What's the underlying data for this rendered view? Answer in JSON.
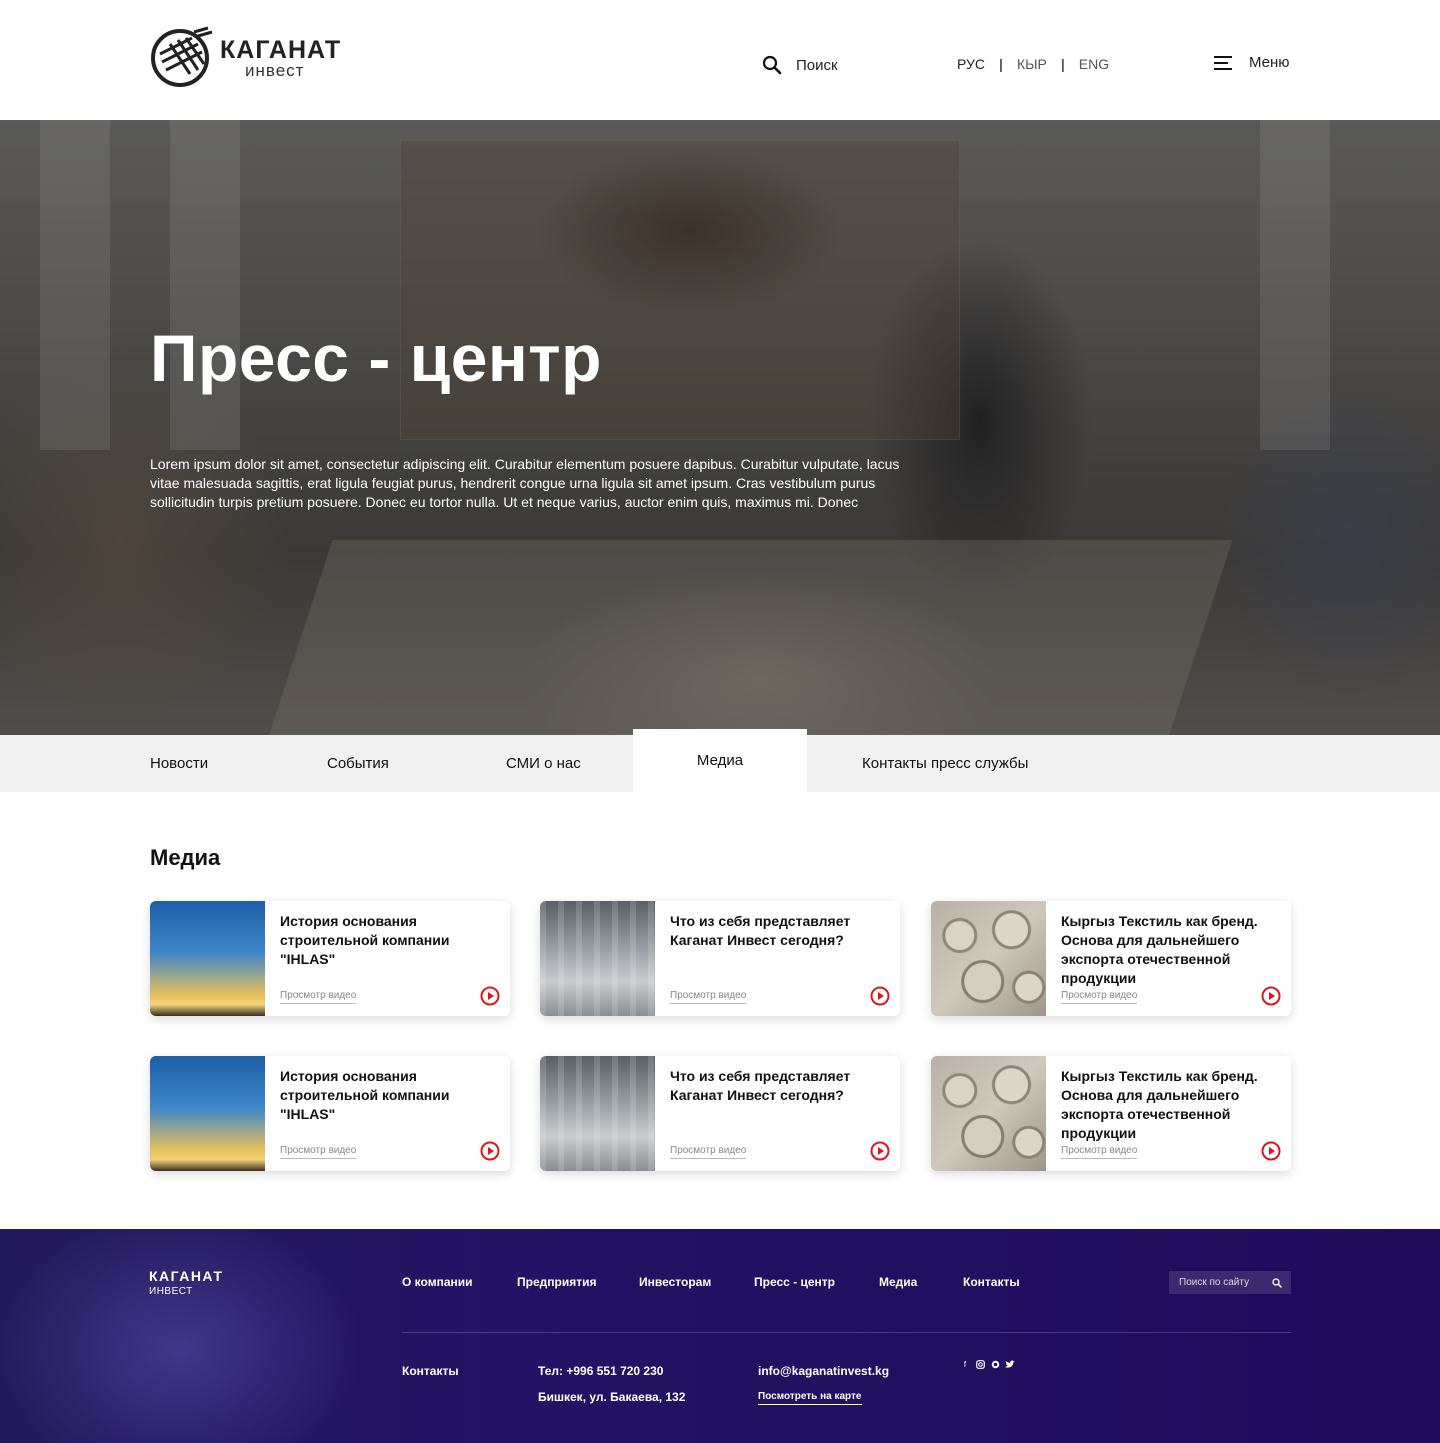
{
  "header": {
    "logo_title": "КАГАНАТ",
    "logo_sub": "инвест",
    "search_label": "Поиск",
    "languages": [
      "РУС",
      "КЫР",
      "ENG"
    ],
    "active_language": "РУС",
    "menu_label": "Меню"
  },
  "hero": {
    "title": "Пресс - центр",
    "text": "Lorem ipsum dolor sit amet, consectetur adipiscing elit. Curabitur elementum posuere dapibus. Curabitur vulputate, lacus vitae malesuada sagittis, erat ligula feugiat purus, hendrerit congue urna ligula sit amet ipsum. Cras vestibulum purus sollicitudin turpis pretium posuere. Donec eu tortor nulla. Ut et neque varius, auctor enim quis, maximus mi. Donec"
  },
  "tabs": [
    {
      "label": "Новости"
    },
    {
      "label": "События"
    },
    {
      "label": "СМИ о нас"
    },
    {
      "label": "Медиа"
    },
    {
      "label": "Контакты пресс службы"
    }
  ],
  "active_tab": "Медиа",
  "media": {
    "title": "Медиа",
    "cards": [
      {
        "title": "История основания строительной компании \"IHLAS\"",
        "link": "Просмотр видео",
        "thumb": "construction-crane-sunset"
      },
      {
        "title": "Что из себя представляет Каганат Инвест сегодня?",
        "link": "Просмотр видео",
        "thumb": "open-office"
      },
      {
        "title": "Кыргыз Текстиль как бренд. Основа для дальнейшего экспорта отечественной продукции",
        "link": "Просмотр видео",
        "thumb": "textile-rolls"
      },
      {
        "title": "История основания строительной компании \"IHLAS\"",
        "link": "Просмотр видео",
        "thumb": "construction-crane-sunset"
      },
      {
        "title": "Что из себя представляет Каганат Инвест сегодня?",
        "link": "Просмотр видео",
        "thumb": "open-office"
      },
      {
        "title": "Кыргыз Текстиль как бренд. Основа для дальнейшего экспорта отечественной продукции",
        "link": "Просмотр видео",
        "thumb": "textile-rolls"
      }
    ]
  },
  "footer": {
    "logo_title": "КАГАНАТ",
    "logo_sub": "ИНВЕСТ",
    "nav": [
      {
        "label": "О компании"
      },
      {
        "label": "Предприятия"
      },
      {
        "label": "Инвесторам"
      },
      {
        "label": "Пресс - центр"
      },
      {
        "label": "Медиа"
      },
      {
        "label": "Контакты"
      }
    ],
    "search_placeholder": "Поиск по сайту",
    "contacts_label": "Контакты",
    "phone": "Тел: +996 551 720 230",
    "address": "Бишкек, ул. Бакаева, 132",
    "email": "info@kaganatinvest.kg",
    "map_link": "Посмотреть на карте",
    "social": [
      "facebook-icon",
      "instagram-icon",
      "whatsapp-icon",
      "twitter-icon"
    ]
  },
  "colors": {
    "accent_red": "#e0151b",
    "footer_purple": "#231364",
    "tab_bar": "#f0f0f0"
  }
}
